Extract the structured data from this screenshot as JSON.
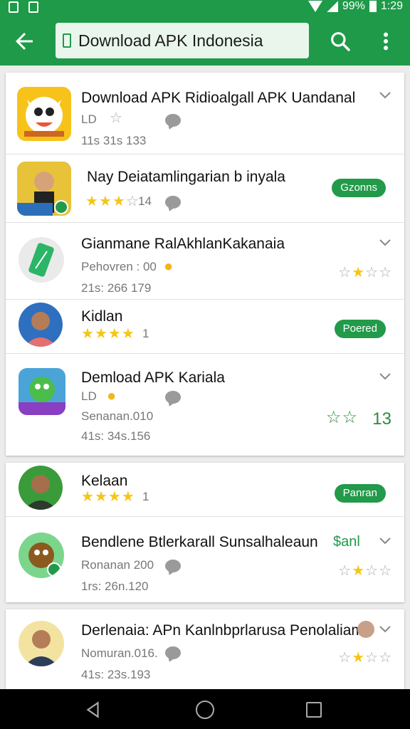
{
  "status_bar": {
    "battery": "99%",
    "time": "1:29"
  },
  "toolbar": {
    "search_text": "Download APK Indonesia"
  },
  "colors": {
    "primary": "#1e9a49",
    "star": "#f5c518",
    "pill": "#229a4a"
  },
  "apps": [
    {
      "title": "Download APK Ridioalgall APK Uandanal",
      "meta1": "LD",
      "meta2": "11s 31s 133",
      "icon": "cartoon-cat-icon"
    },
    {
      "title": "Nay Deiatamlingarian b inyala",
      "rating_text": "14",
      "button": "Gzonns",
      "icon": "man-portrait-icon"
    },
    {
      "title": "Gianmane RalAkhlanKakanaia",
      "meta1": "Pehovren : 00",
      "meta2": "21s: 266 179",
      "icon": "green-phone-icon"
    },
    {
      "title": "Kidlan",
      "rating_text": "1",
      "button": "Poered",
      "icon": "man-avatar-icon"
    },
    {
      "title": "Demload APK Kariala",
      "meta1": "LD",
      "meta2": "Senanan.010",
      "meta3": "41s: 34s.156",
      "score": "13",
      "icon": "green-creature-icon"
    },
    {
      "title": "Kelaan",
      "rating_text": "1",
      "button": "Panran",
      "icon": "man-avatar-icon"
    },
    {
      "title": "Bendlene Btlerkarall Sunsalhaleaun",
      "price": "$anl",
      "meta1": "Ronanan 200",
      "meta2": "1rs: 26n.120",
      "icon": "brown-creature-icon"
    },
    {
      "title": "Derlenaia: APn Kanlnbprlarusa Penolaliam:",
      "meta1": "Nomuran.016.",
      "meta2": "41s: 23s.193",
      "icon": "man-avatar-icon"
    }
  ]
}
